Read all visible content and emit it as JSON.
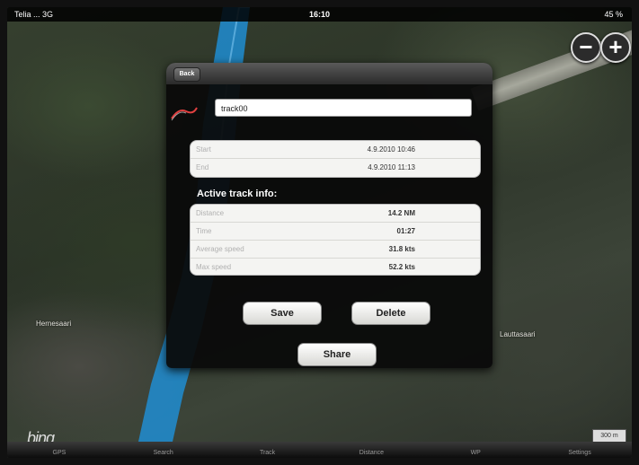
{
  "status_bar": {
    "carrier": "Telia ... 3G",
    "time": "16:10",
    "battery": "45 %"
  },
  "map": {
    "zoom_out": "−",
    "zoom_in": "+",
    "labels": [
      "Hernesaari",
      "Lauttasaari"
    ],
    "brand": "bing",
    "scale_text": "300 m"
  },
  "dialog": {
    "back_label": "Back",
    "track_name": "track00",
    "dates": [
      {
        "label": "Start",
        "value": "4.9.2010 10:46"
      },
      {
        "label": "End",
        "value": "4.9.2010 11:13"
      }
    ],
    "active_title": "Active track info:",
    "info": [
      {
        "label": "Distance",
        "value": "14.2 NM"
      },
      {
        "label": "Time",
        "value": "01:27"
      },
      {
        "label": "Average speed",
        "value": "31.8 kts"
      },
      {
        "label": "Max speed",
        "value": "52.2 kts"
      }
    ],
    "save_label": "Save",
    "delete_label": "Delete",
    "share_label": "Share"
  },
  "tab_bar": {
    "tabs": [
      "GPS",
      "Search",
      "Track",
      "Distance",
      "WP",
      "Settings"
    ]
  },
  "colors": {
    "river": "#1e90d8",
    "dialog_bg": "#0a0a0a",
    "panel_bg": "#f4f4f2"
  }
}
